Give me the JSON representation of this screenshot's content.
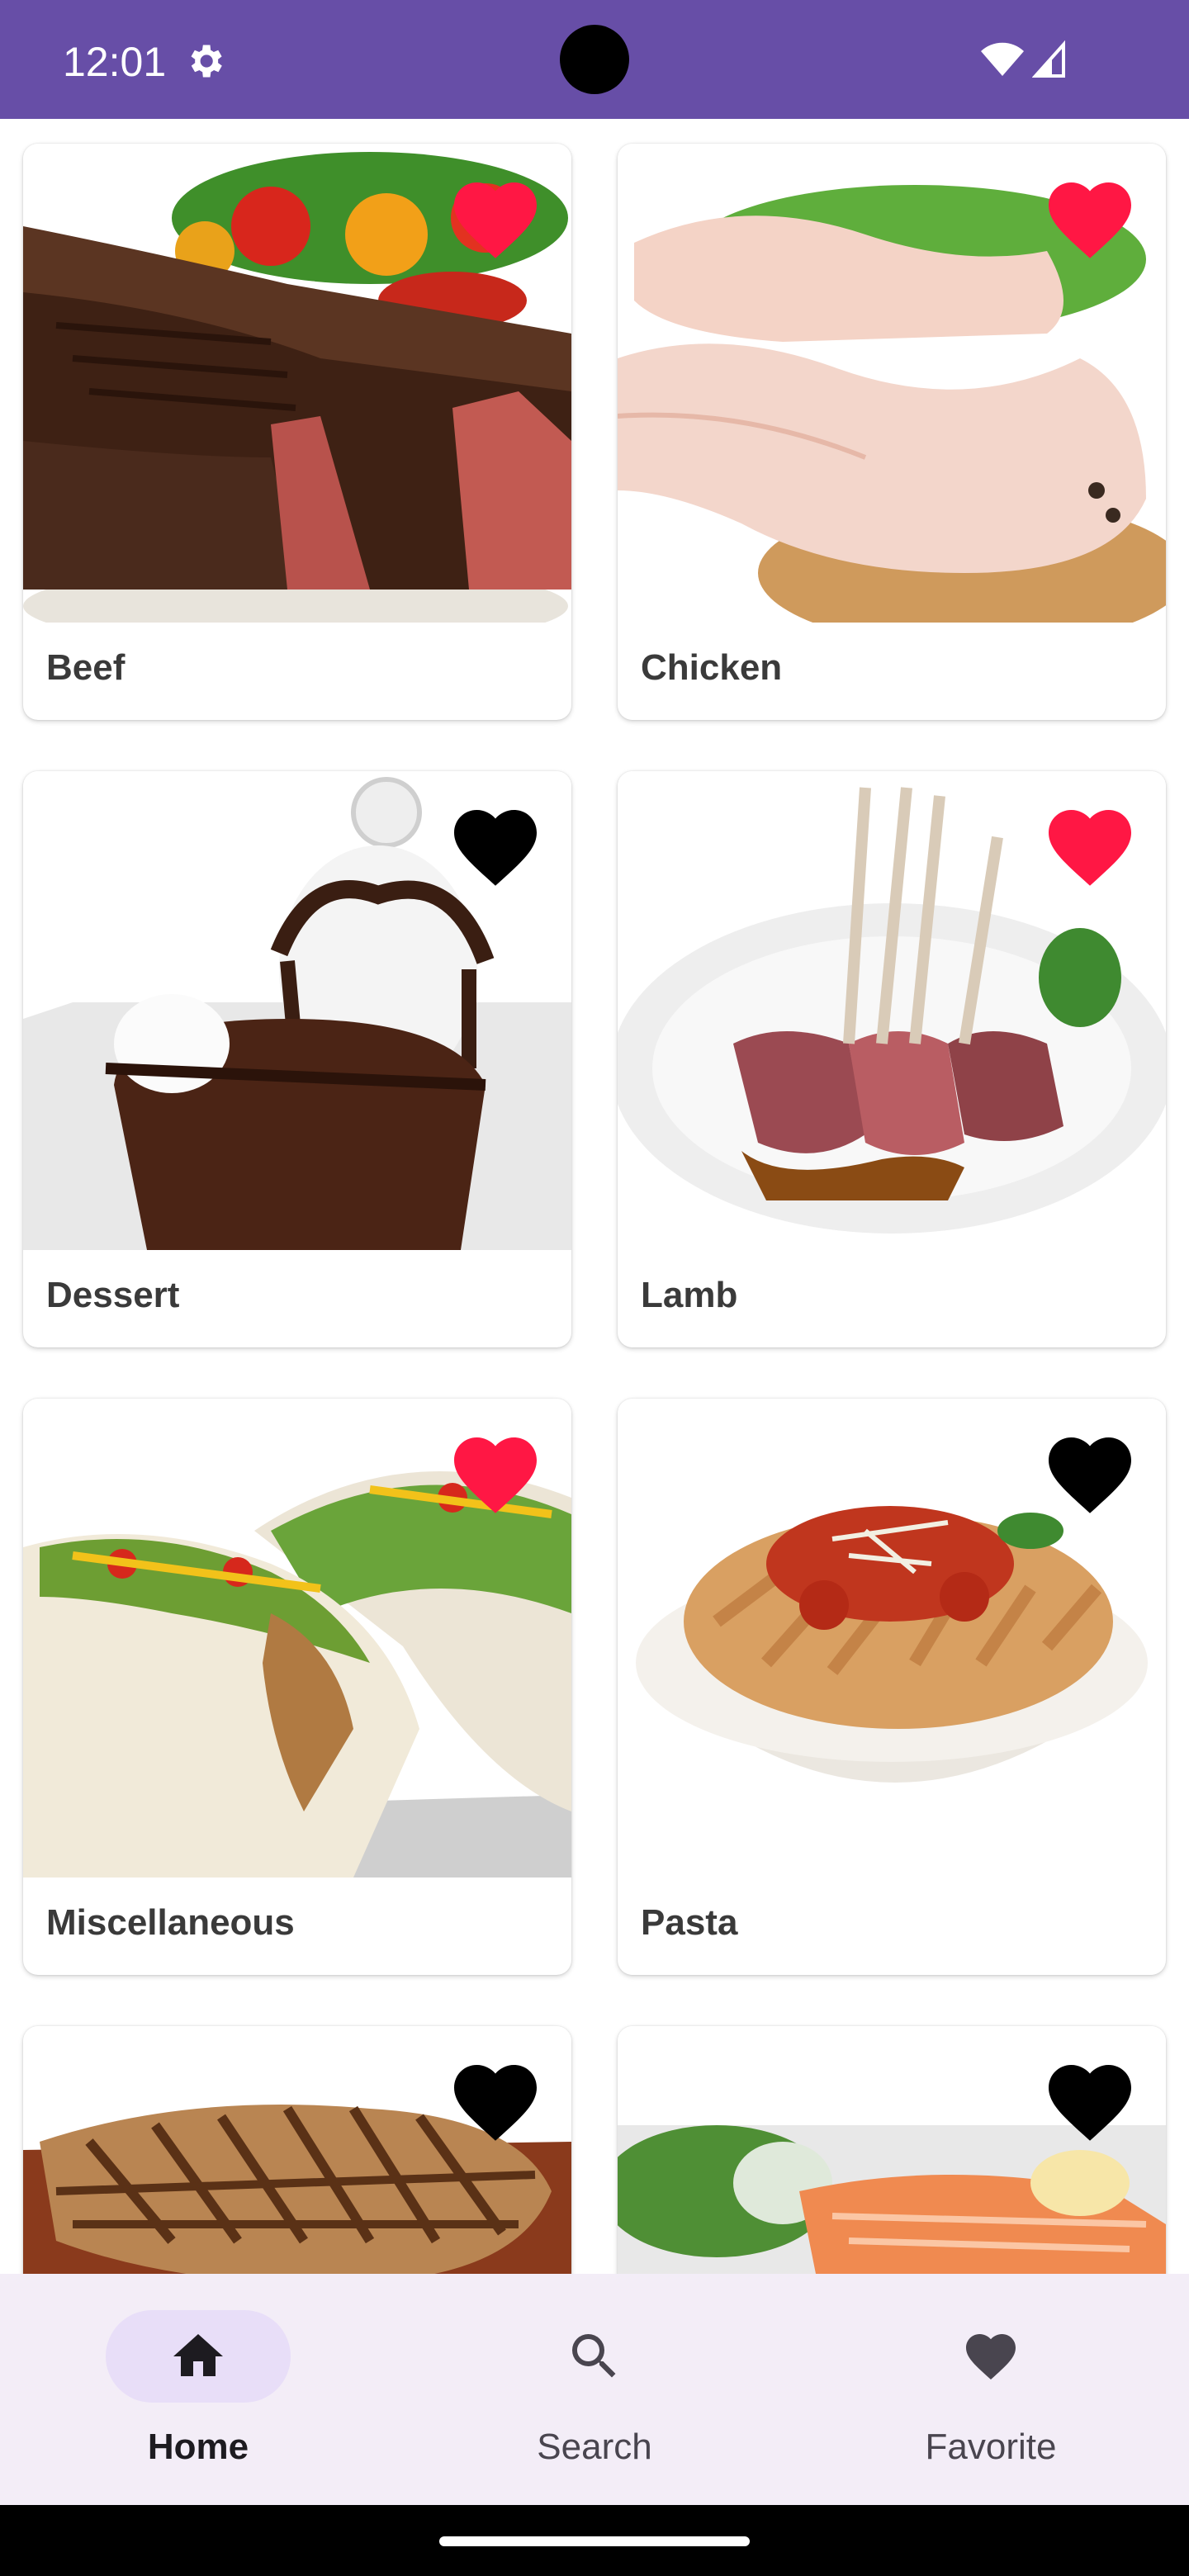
{
  "status_bar": {
    "time": "12:01",
    "background": "#674ea7",
    "icons": [
      "gear-icon",
      "wifi-icon",
      "signal-icon"
    ]
  },
  "categories": [
    {
      "label": "Beef",
      "favorited": true
    },
    {
      "label": "Chicken",
      "favorited": true
    },
    {
      "label": "Dessert",
      "favorited": false
    },
    {
      "label": "Lamb",
      "favorited": true
    },
    {
      "label": "Miscellaneous",
      "favorited": true
    },
    {
      "label": "Pasta",
      "favorited": false
    },
    {
      "label": "",
      "favorited": false
    },
    {
      "label": "",
      "favorited": false
    }
  ],
  "favorite_colors": {
    "on": "#ff1744",
    "off": "#000000"
  },
  "bottom_nav": {
    "items": [
      {
        "label": "Home",
        "icon": "home-icon",
        "selected": true
      },
      {
        "label": "Search",
        "icon": "search-icon",
        "selected": false
      },
      {
        "label": "Favorite",
        "icon": "heart-icon",
        "selected": false
      }
    ],
    "background": "#f3edf7",
    "selected_pill": "#e8def8"
  }
}
